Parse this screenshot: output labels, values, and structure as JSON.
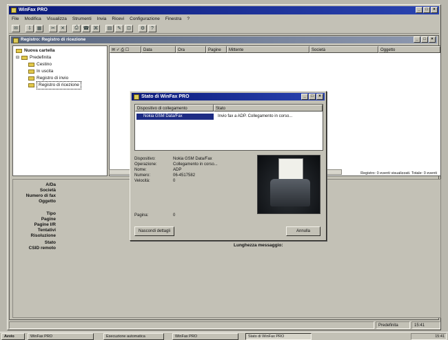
{
  "app": {
    "title": "WinFax PRO"
  },
  "menu": [
    "File",
    "Modifica",
    "Visualizza",
    "Strumenti",
    "Invia",
    "Ricevi",
    "Configurazione",
    "Finestra",
    "?"
  ],
  "inner_window": {
    "title": "Registro: Registro di ricezione"
  },
  "tree": {
    "root": "Nuova cartella",
    "predefinita": "Predefinita",
    "items": [
      "Cestino",
      "In uscita",
      "Registro di invio",
      "Registro di ricezione"
    ]
  },
  "list": {
    "columns": [
      "Data",
      "Ora",
      "Pagine",
      "Mittente",
      "Società",
      "Oggetto"
    ],
    "status": "Registro: 0 eventi visualizzati. Totale: 0 eventi"
  },
  "details": {
    "labels": [
      "A/Da",
      "Società",
      "Numero di fax",
      "Oggetto",
      "Tipo",
      "Pagine",
      "Pagine I/R",
      "Tentativi",
      "Risoluzione",
      "Stato",
      "CSID remoto"
    ],
    "message_length": "Lunghezza messaggio:"
  },
  "dialog": {
    "title": "Stato di WinFax PRO",
    "col_device": "Dispositivo di collegamento",
    "col_state": "Stato",
    "row_device": "Nokia GSM Data/Fax",
    "row_state": "Invio fax a ADP. Collegamento in corso...",
    "info": {
      "device_label": "Dispositivo:",
      "device": "Nokia GSM Data/Fax",
      "op_label": "Operazione:",
      "op": "Collegamento in corso...",
      "name_label": "Nome:",
      "name": "ADP",
      "number_label": "Numero:",
      "number": "06-4517582",
      "speed_label": "Velocità:",
      "speed": "0",
      "page_label": "Pagina:",
      "page": "0"
    },
    "hide_button": "Nascondi dettagli",
    "cancel_button": "Annulla"
  },
  "statusbar": {
    "left": "",
    "right1": "Predefinita",
    "right2": "15:41"
  },
  "taskbar": {
    "start": "Avvio",
    "tasks": [
      "WinFax PRO",
      "Esecuzione automatica",
      "WinFax PRO",
      "Stato di WinFax PRO"
    ],
    "clock": "15:41"
  }
}
